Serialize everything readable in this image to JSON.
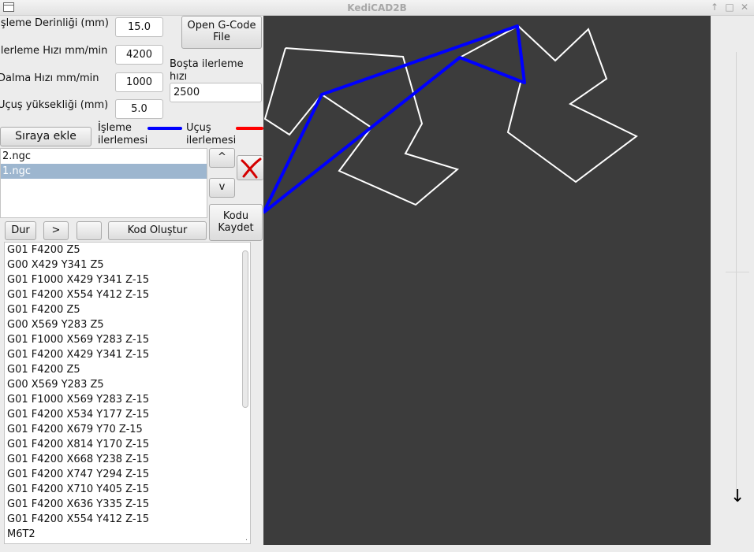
{
  "window": {
    "title": "KediCAD2B",
    "controls": [
      "↑",
      "□",
      "✕"
    ]
  },
  "settings": {
    "depth_label": "İşleme Derinliği (mm)",
    "depth_value": "15.0",
    "feed_label": "İlerleme Hızı mm/min",
    "feed_value": "4200",
    "plunge_label": "Dalma Hızı mm/min",
    "plunge_value": "1000",
    "flight_label": "Uçuş yüksekliği (mm)",
    "flight_value": "5.0",
    "idle_label_line1": "Boşta ilerleme",
    "idle_label_line2": "hızı",
    "idle_value": "2500"
  },
  "buttons": {
    "open_gcode_line1": "Open G-Code",
    "open_gcode_line2": "File",
    "add_queue": "Sıraya ekle",
    "up": "^",
    "down": "v",
    "save_line1": "Kodu",
    "save_line2": "Kaydet",
    "stop": "Dur",
    "play": ">",
    "blank": "",
    "generate": "Kod Oluştur"
  },
  "legend": {
    "process_line1": "İşleme",
    "process_line2": "ilerlemesi",
    "process_color": "#0000ff",
    "flight_line1": "Uçuş",
    "flight_line2": "ilerlemesi",
    "flight_color": "#ff0000"
  },
  "files": [
    {
      "name": "2.ngc",
      "selected": false
    },
    {
      "name": "1.ngc",
      "selected": true
    }
  ],
  "gcode_lines": [
    "G01 F4200 Z5",
    "G00 X429 Y341 Z5",
    "G01 F1000 X429 Y341 Z-15",
    "G01 F4200 X554 Y412 Z-15",
    "G01 F4200 Z5",
    "G00 X569 Y283 Z5",
    "G01 F1000 X569 Y283 Z-15",
    "G01 F4200 X429 Y341 Z-15",
    "G01 F4200 Z5",
    "G00 X569 Y283 Z5",
    "G01 F1000 X569 Y283 Z-15",
    "G01 F4200 X534 Y177 Z-15",
    "G01 F4200 X679 Y70 Z-15",
    "G01 F4200 X814 Y170 Z-15",
    "G01 F4200 X668 Y238 Z-15",
    "G01 F4200 X747 Y294 Z-15",
    "G01 F4200 X710 Y405 Z-15",
    "G01 F4200 X636 Y335 Z-15",
    "G01 F4200 X554 Y412 Z-15",
    "M6T2"
  ],
  "colors": {
    "canvas_bg": "#3c3c3c",
    "shape_outline": "#ffffff",
    "process_path": "#0000ff"
  }
}
